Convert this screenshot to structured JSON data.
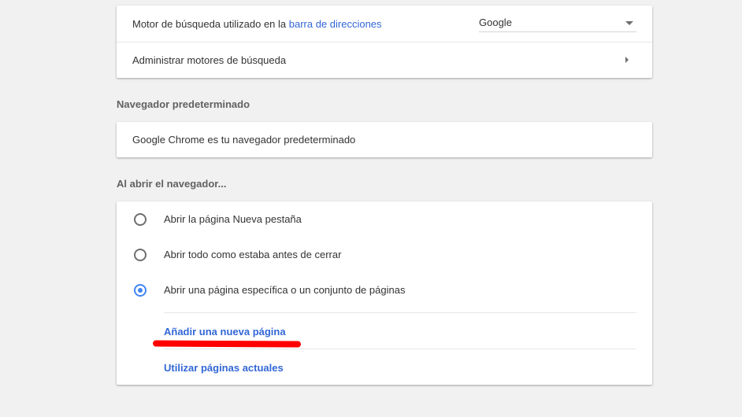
{
  "search_engine": {
    "label_prefix": "Motor de búsqueda utilizado en la ",
    "label_link": "barra de direcciones",
    "selected_engine": "Google",
    "manage_label": "Administrar motores de búsqueda"
  },
  "default_browser": {
    "heading": "Navegador predeterminado",
    "status_text": "Google Chrome es tu navegador predeterminado"
  },
  "on_startup": {
    "heading": "Al abrir el navegador...",
    "options": [
      {
        "label": "Abrir la página Nueva pestaña",
        "checked": false
      },
      {
        "label": "Abrir todo como estaba antes de cerrar",
        "checked": false
      },
      {
        "label": "Abrir una página específica o un conjunto de páginas",
        "checked": true
      }
    ],
    "add_page_label": "Añadir una nueva página",
    "use_current_label": "Utilizar páginas actuales"
  },
  "colors": {
    "accent": "#4285f4",
    "link": "#3367d6",
    "annotation": "#ff0000"
  }
}
